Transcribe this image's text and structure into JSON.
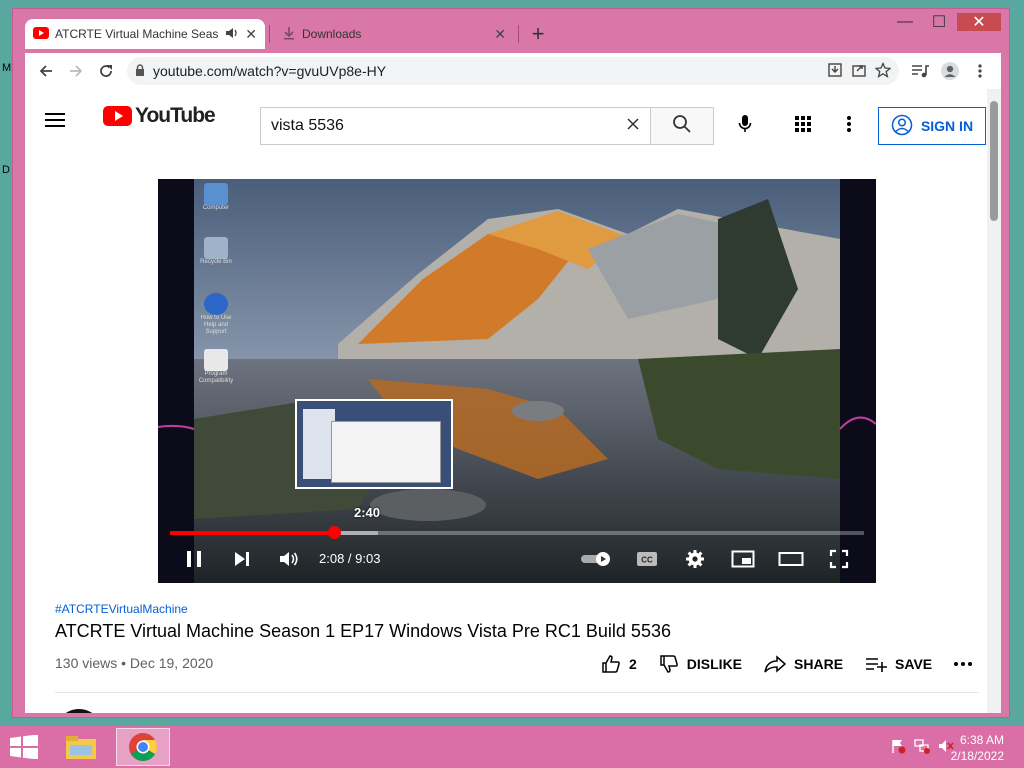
{
  "desktop": {
    "edge_labels": [
      "M",
      "D"
    ]
  },
  "window": {
    "controls": {
      "minimize": "—",
      "maximize": "☐",
      "close": "✕"
    }
  },
  "tabs": [
    {
      "title": "ATCRTE Virtual Machine Seas",
      "icon": "youtube-favicon",
      "audio": "speaker-icon"
    },
    {
      "title": "Downloads",
      "icon": "download-icon"
    }
  ],
  "toolbar": {
    "url": "youtube.com/watch?v=gvuUVp8e-HY"
  },
  "youtube": {
    "brand": "YouTube",
    "search_query": "vista 5536",
    "sign_in": "SIGN IN"
  },
  "player": {
    "preview_time": "2:40",
    "time_display": "2:08 / 9:03",
    "progress_played": 0.236,
    "progress_buffered": 0.3,
    "desktop_icons": [
      "Computer",
      "Recycle Bin",
      "How to Use Help and Support",
      "Program Compatibility"
    ]
  },
  "video": {
    "hashtag": "#ATCRTEVirtualMachine",
    "title": "ATCRTE Virtual Machine Season 1 EP17 Windows Vista Pre RC1 Build 5536",
    "meta": "130 views • Dec 19, 2020",
    "like_count": "2",
    "dislike": "DISLIKE",
    "share": "SHARE",
    "save": "SAVE"
  },
  "taskbar": {
    "clock_time": "6:38 AM",
    "clock_date": "2/18/2022",
    "apps": [
      "file-explorer",
      "chrome"
    ]
  },
  "colors": {
    "yt_red": "#ff0000",
    "link_blue": "#065fd4",
    "window_pink": "#d977a8"
  }
}
